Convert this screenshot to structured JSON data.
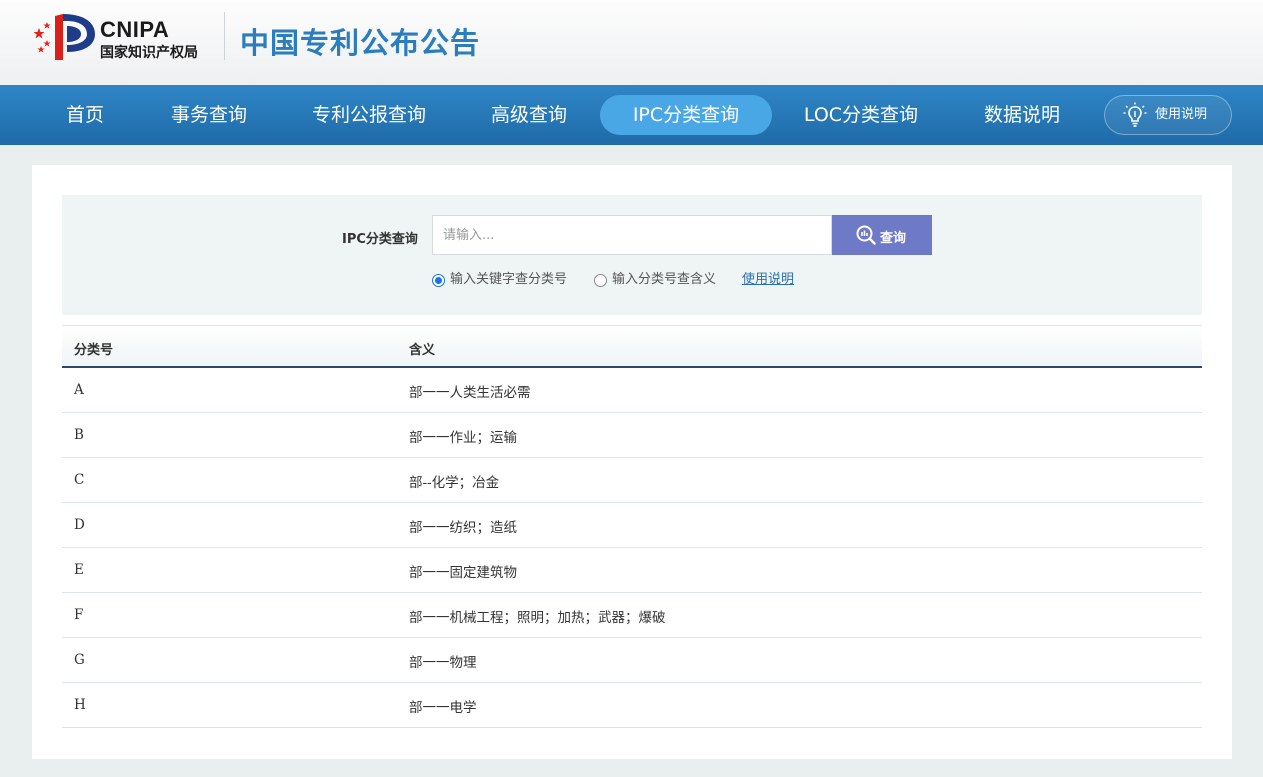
{
  "header": {
    "logo_en": "CNIPA",
    "logo_cn": "国家知识产权局",
    "site_title": "中国专利公布公告"
  },
  "nav": {
    "items": [
      {
        "label": "首页"
      },
      {
        "label": "事务查询"
      },
      {
        "label": "专利公报查询"
      },
      {
        "label": "高级查询"
      },
      {
        "label": "IPC分类查询",
        "active": true
      },
      {
        "label": "LOC分类查询"
      },
      {
        "label": "数据说明"
      }
    ],
    "help_label": "使用说明",
    "active_color": "#4aa7e6"
  },
  "search": {
    "label": "IPC分类查询",
    "placeholder": "请输入...",
    "value": "",
    "button_label": "查询",
    "button_color": "#6e79c7",
    "options": [
      {
        "label": "输入关键字查分类号",
        "checked": true
      },
      {
        "label": "输入分类号查含义",
        "checked": false
      }
    ],
    "help_link": "使用说明"
  },
  "table": {
    "columns": [
      "分类号",
      "含义"
    ],
    "rows": [
      {
        "code": "A",
        "desc": "部一一人类生活必需"
      },
      {
        "code": "B",
        "desc": "部一一作业；运输"
      },
      {
        "code": "C",
        "desc": "部--化学；冶金"
      },
      {
        "code": "D",
        "desc": "部一一纺织；造纸"
      },
      {
        "code": "E",
        "desc": "部一一固定建筑物"
      },
      {
        "code": "F",
        "desc": "部一一机械工程；照明；加热；武器；爆破"
      },
      {
        "code": "G",
        "desc": "部一一物理"
      },
      {
        "code": "H",
        "desc": "部一一电学"
      }
    ]
  }
}
